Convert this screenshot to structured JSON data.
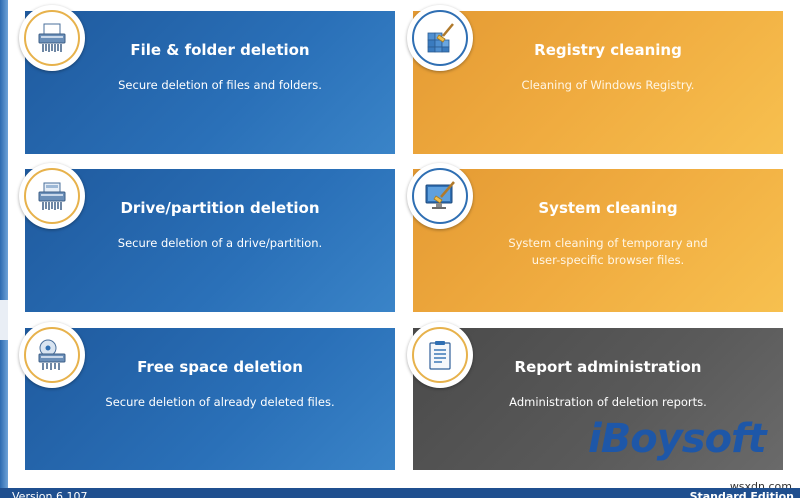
{
  "tiles": [
    {
      "title": "File & folder deletion",
      "description": "Secure deletion of files and folders.",
      "icon": "shredder-icon"
    },
    {
      "title": "Registry cleaning",
      "description": "Cleaning of Windows Registry.",
      "icon": "registry-cube-icon"
    },
    {
      "title": "Drive/partition deletion",
      "description": "Secure deletion of a drive/partition.",
      "icon": "drive-shredder-icon"
    },
    {
      "title": "System cleaning",
      "description_line1": "System cleaning of temporary and",
      "description_line2": "user-specific browser files.",
      "icon": "monitor-broom-icon"
    },
    {
      "title": "Free space deletion",
      "description": "Secure deletion of already deleted files.",
      "icon": "disc-shredder-icon"
    },
    {
      "title": "Report administration",
      "description": "Administration of deletion reports.",
      "icon": "report-clipboard-icon"
    }
  ],
  "statusbar": {
    "version": "Version 6.107",
    "edition": "Standard Edition"
  },
  "watermark": {
    "brand": "iBoysoft",
    "site": "wsxdn.com"
  },
  "colors": {
    "blue": "#2a70b8",
    "orange": "#f0ac40",
    "gray": "#555555",
    "ring": "#e7b24c"
  }
}
